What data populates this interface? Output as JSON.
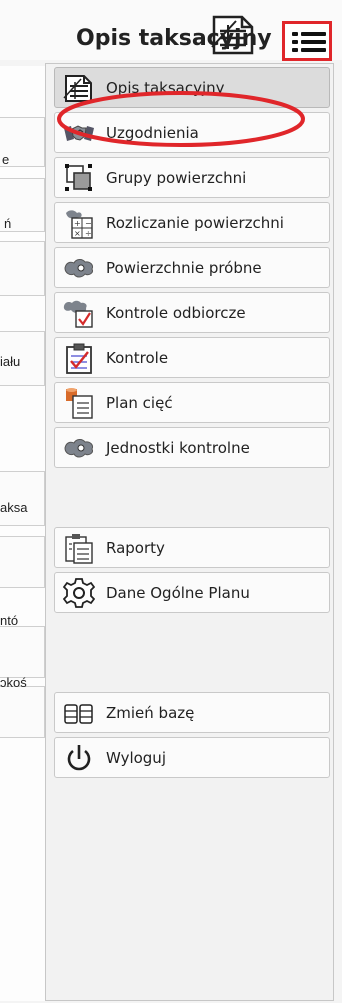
{
  "header": {
    "title": "Opis taksacyjny",
    "menu_icon": "hamburger-menu-icon",
    "doc_icon": "document-icon",
    "highlight_color": "#e0262a"
  },
  "background_panel": {
    "fragments": [
      "e",
      "ń",
      "iału",
      "aksa",
      "ntó",
      "ɔkoś"
    ]
  },
  "menu": {
    "items": [
      {
        "label": "Opis taksacyjny",
        "icon": "document-list-icon",
        "active": true
      },
      {
        "label": "Uzgodnienia",
        "icon": "handshake-icon"
      },
      {
        "label": "Grupy powierzchni",
        "icon": "group-squares-icon"
      },
      {
        "label": "Rozliczanie powierzchni",
        "icon": "calculator-icon"
      },
      {
        "label": "Powierzchnie próbne",
        "icon": "sample-area-icon"
      },
      {
        "label": "Kontrole odbiorcze",
        "icon": "acceptance-check-icon"
      },
      {
        "label": "Kontrole",
        "icon": "clipboard-check-icon"
      },
      {
        "label": "Plan cięć",
        "icon": "cut-plan-icon"
      },
      {
        "label": "Jednostki kontrolne",
        "icon": "control-units-icon"
      },
      {
        "label": "Raporty",
        "icon": "reports-icon"
      },
      {
        "label": "Dane Ogólne Planu",
        "icon": "gear-icon"
      },
      {
        "label": "Zmień bazę",
        "icon": "database-icon"
      },
      {
        "label": "Wyloguj",
        "icon": "power-icon"
      }
    ]
  }
}
